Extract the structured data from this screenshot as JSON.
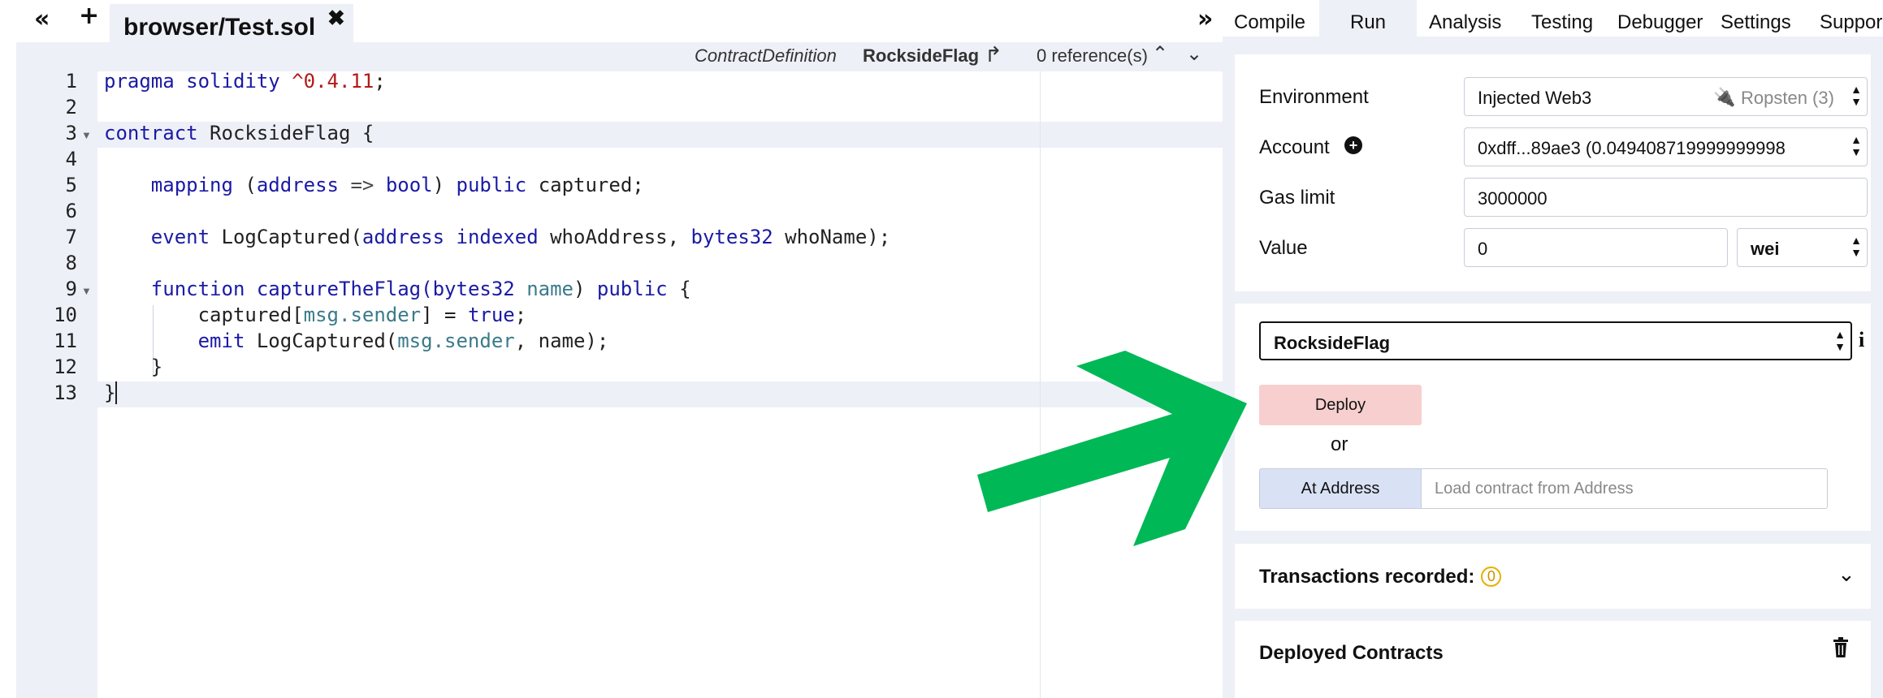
{
  "editor": {
    "collapse_left": "«",
    "add_file": "+",
    "file_tab": {
      "name": "browser/Test.sol",
      "close": "✖"
    },
    "info": {
      "kind": "ContractDefinition",
      "contract": "RocksideFlag",
      "share": "↱",
      "refs": "0 reference(s)",
      "up": "⌃",
      "down": "⌄"
    },
    "lines": [
      {
        "n": "1"
      },
      {
        "n": "2"
      },
      {
        "n": "3"
      },
      {
        "n": "4"
      },
      {
        "n": "5"
      },
      {
        "n": "6"
      },
      {
        "n": "7"
      },
      {
        "n": "8"
      },
      {
        "n": "9"
      },
      {
        "n": "10"
      },
      {
        "n": "11"
      },
      {
        "n": "12"
      },
      {
        "n": "13"
      }
    ],
    "code": {
      "l1": [
        "pragma",
        "solidity",
        "^0.4.11",
        ";"
      ],
      "l3": [
        "contract",
        "RocksideFlag {"
      ],
      "l5": [
        "mapping",
        "(",
        "address",
        "=>",
        "bool",
        ")",
        "public",
        "captured;"
      ],
      "l7": [
        "event",
        "LogCaptured(",
        "address",
        "indexed",
        "whoAddress,",
        "bytes32",
        "whoName);"
      ],
      "l9": [
        "function",
        "captureTheFlag(",
        "bytes32",
        "name",
        ")",
        "public",
        "{"
      ],
      "l10": [
        "captured[",
        "msg.sender",
        "] = ",
        "true",
        ";"
      ],
      "l11": [
        "emit",
        "LogCaptured(",
        "msg.sender",
        ", name);"
      ],
      "l12": [
        "}"
      ],
      "l13": [
        "}"
      ]
    }
  },
  "panel": {
    "collapse": "»",
    "tabs": [
      "Compile",
      "Run",
      "Analysis",
      "Testing",
      "Debugger",
      "Settings",
      "Suppor"
    ],
    "active_tab": "Run",
    "environment": {
      "label": "Environment",
      "value": "Injected Web3",
      "network": "Ropsten (3)"
    },
    "account": {
      "label": "Account",
      "value": "0xdff...89ae3 (0.049408719999999998"
    },
    "gas_limit": {
      "label": "Gas limit",
      "value": "3000000"
    },
    "value": {
      "label": "Value",
      "amount": "0",
      "unit": "wei"
    },
    "contract_select": "RocksideFlag",
    "deploy": "Deploy",
    "or": "or",
    "at_address": "At Address",
    "load_placeholder": "Load contract from Address",
    "transactions": {
      "label": "Transactions recorded:",
      "count": "0"
    },
    "deployed": {
      "label": "Deployed Contracts"
    }
  },
  "colors": {
    "arrow": "#00b856",
    "deploy_bg": "#f7cfcf",
    "at_address_bg": "#d9e1f5",
    "panel_bg": "#eef0f8"
  }
}
